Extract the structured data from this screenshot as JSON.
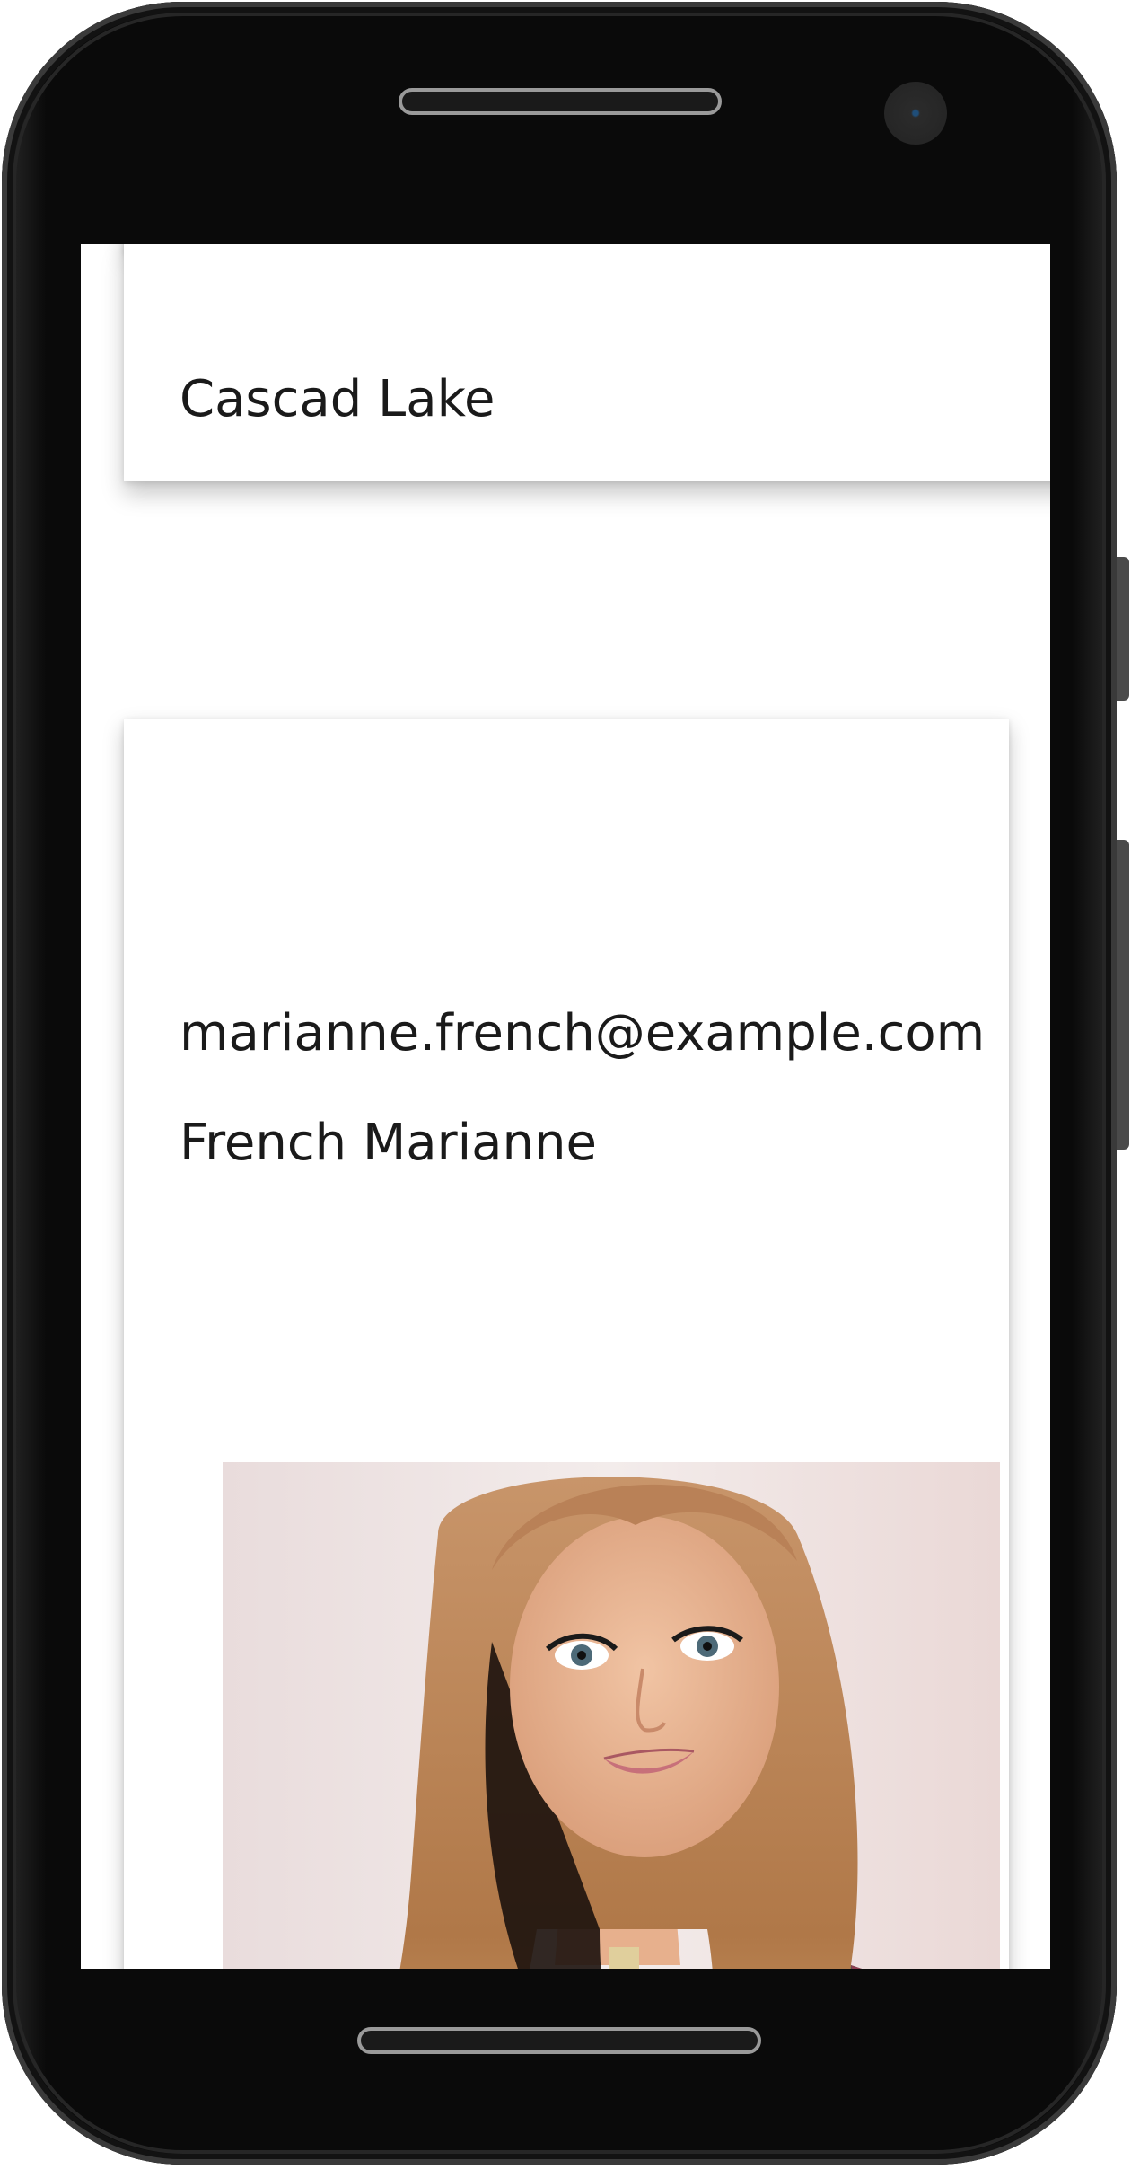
{
  "cards": {
    "place": {
      "title": "Cascad Lake"
    },
    "contact": {
      "email": "marianne.french@example.com",
      "name": "French Marianne"
    }
  },
  "icons": {
    "speaker": "earpiece-speaker",
    "camera": "front-camera-icon"
  }
}
